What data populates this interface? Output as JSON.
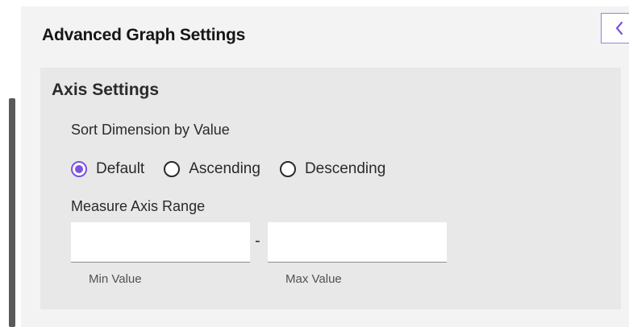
{
  "panel": {
    "title": "Advanced Graph Settings",
    "collapse_icon": "chevron-left-icon"
  },
  "axis_settings": {
    "title": "Axis Settings",
    "sort": {
      "label": "Sort Dimension by Value",
      "options": [
        {
          "label": "Default",
          "selected": true
        },
        {
          "label": "Ascending",
          "selected": false
        },
        {
          "label": "Descending",
          "selected": false
        }
      ]
    },
    "measure_range": {
      "label": "Measure Axis Range",
      "separator": "-",
      "min": {
        "value": "",
        "helper": "Min Value"
      },
      "max": {
        "value": "",
        "helper": "Max Value"
      }
    }
  },
  "colors": {
    "accent": "#7d52e0",
    "panel_bg": "#f3f3f3",
    "section_bg": "#e8e8e8"
  }
}
